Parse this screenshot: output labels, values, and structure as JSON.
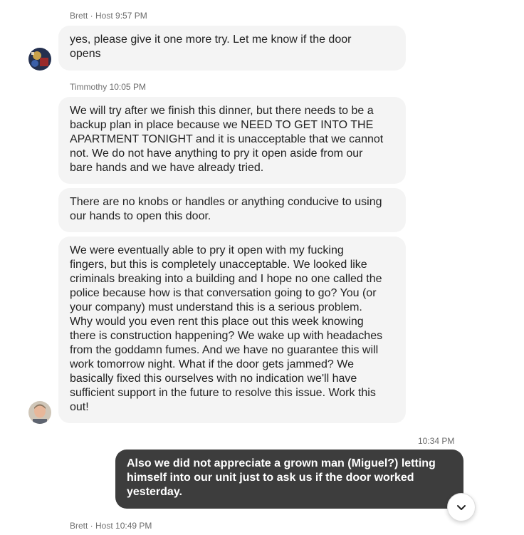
{
  "messages": [
    {
      "sender": "Brett",
      "role": "Host",
      "separator": " · ",
      "time": "9:57 PM",
      "bubbles": [
        "yes, please give it one more try. Let me know if the door\nopens"
      ]
    },
    {
      "sender": "Timmothy",
      "time": "10:05 PM",
      "bubbles": [
        "We will try after we finish this dinner, but there needs to be a\nbackup plan in place because we NEED TO GET INTO THE\nAPARTMENT TONIGHT and it is unacceptable that we cannot\nnot. We do not have anything to pry it open aside from our\nbare hands and we have already tried.",
        "There are no knobs or handles or anything conducive to using\nour hands to open this door.",
        "We were eventually able to pry it open with my fucking\nfingers, but this is completely unacceptable. We looked like\ncriminals breaking into a building and I hope no one called the\npolice because how is that conversation going to go? You (or\nyour company) must understand this is a serious problem.\nWhy would you even rent this place out this week knowing\nthere is construction happening? We wake up with headaches\nfrom the goddamn fumes. And we have no guarantee this will\nwork tomorrow night. What if the door gets jammed? We\nbasically fixed this ourselves with no indication we'll have\nsufficient support in the future to resolve this issue. Work this\nout!"
      ]
    },
    {
      "sender": "",
      "time": "10:34 PM",
      "bubbles": [
        "Also we did not appreciate a grown man (Miguel?) letting\nhimself into our unit just to ask us if the door worked\nyesterday."
      ]
    },
    {
      "sender": "Brett",
      "role": "Host",
      "separator": " · ",
      "time": "10:49 PM",
      "bubbles": []
    }
  ],
  "scroll_button": {
    "icon": "chevron-down-icon"
  },
  "colors": {
    "incoming_bubble": "#f4f4f4",
    "outgoing_bubble": "#3d3d3d",
    "meta_text": "#6a6a6a"
  }
}
